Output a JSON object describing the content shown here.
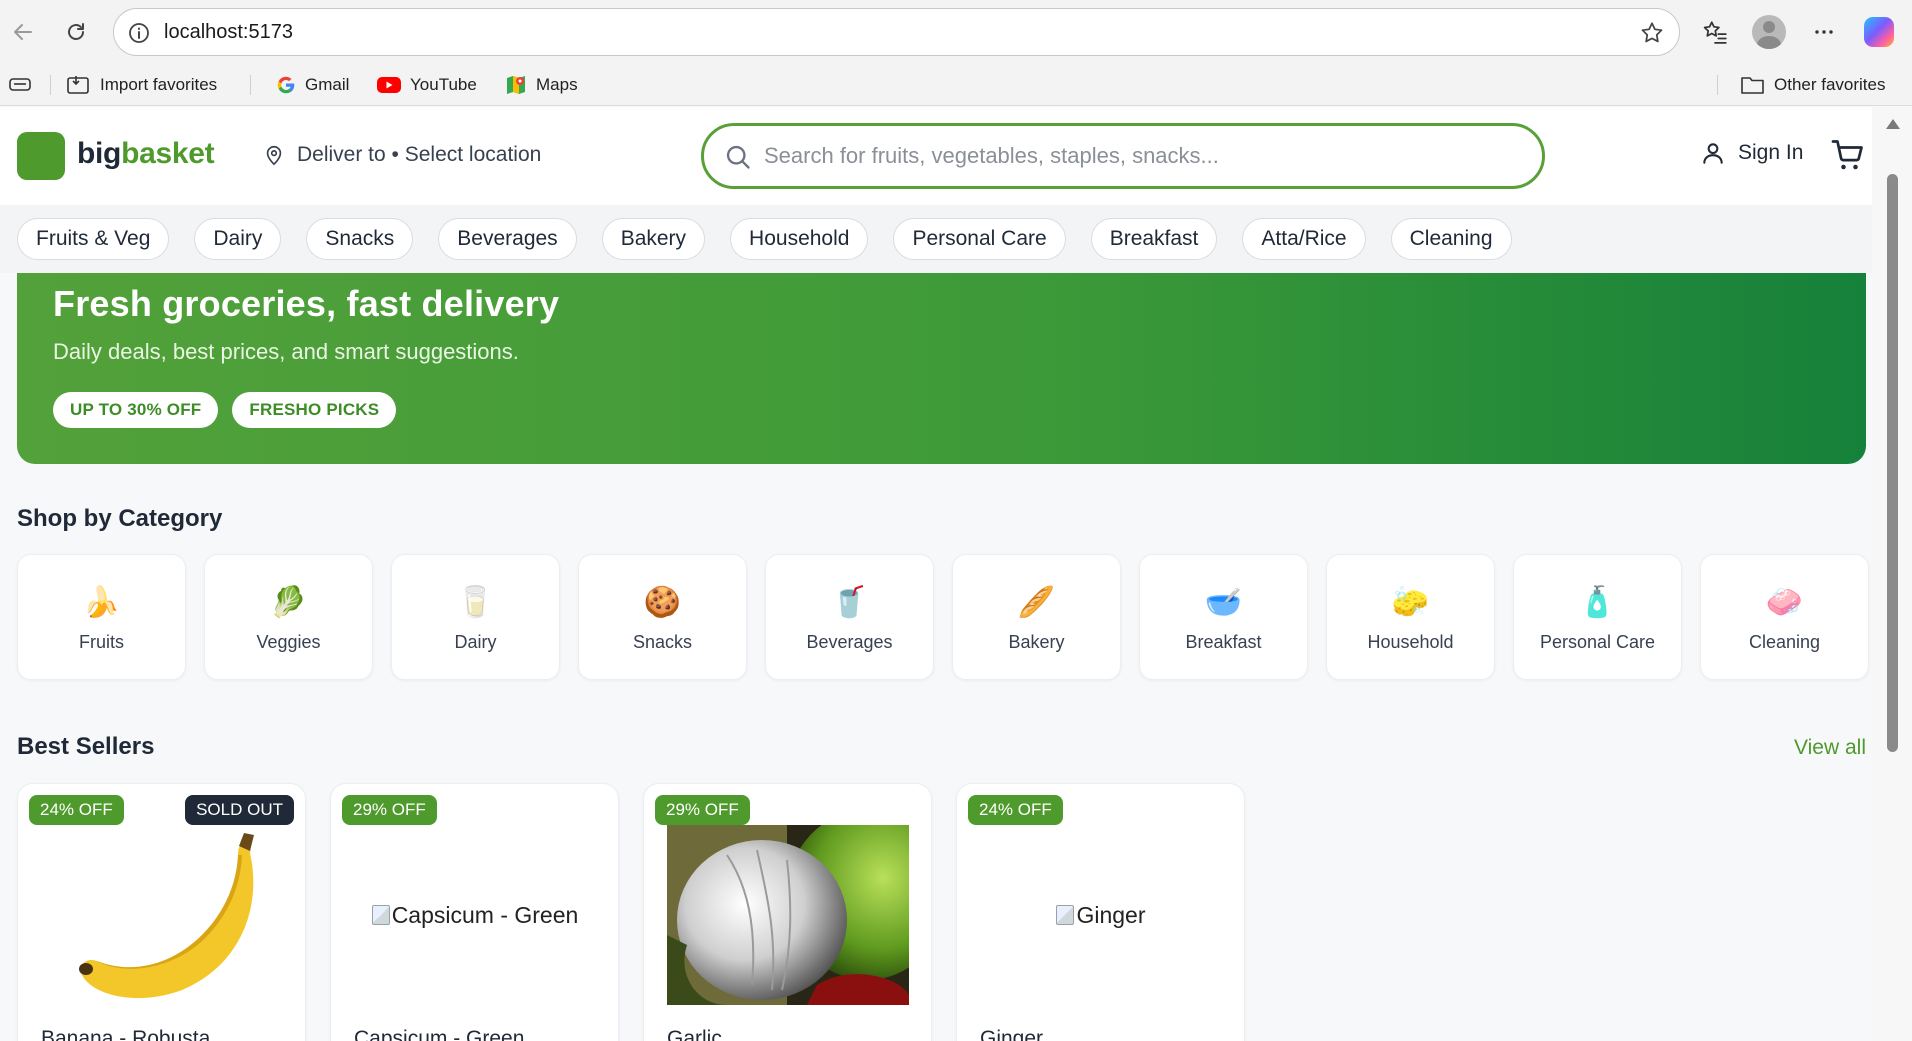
{
  "browser": {
    "url": "localhost:5173",
    "favorites": [
      {
        "label": "Import favorites",
        "icon": "import-favorites-icon"
      },
      {
        "label": "Gmail",
        "icon": "google-icon"
      },
      {
        "label": "YouTube",
        "icon": "youtube-icon"
      },
      {
        "label": "Maps",
        "icon": "maps-icon"
      }
    ],
    "other_favorites": "Other favorites"
  },
  "header": {
    "logo_big": "big",
    "logo_basket": "basket",
    "deliver_text": "Deliver to • Select location",
    "search_placeholder": "Search for fruits, vegetables, staples, snacks...",
    "sign_in": "Sign In",
    "brand_color": "#4f9a2c"
  },
  "nav_categories": [
    "Fruits & Veg",
    "Dairy",
    "Snacks",
    "Beverages",
    "Bakery",
    "Household",
    "Personal Care",
    "Breakfast",
    "Atta/Rice",
    "Cleaning"
  ],
  "hero": {
    "title": "Fresh groceries, fast delivery",
    "subtitle": "Daily deals, best prices, and smart suggestions.",
    "badges": [
      "UP TO 30% OFF",
      "FRESHO PICKS"
    ]
  },
  "shop_by_category": {
    "title": "Shop by Category",
    "items": [
      {
        "label": "Fruits",
        "emoji": "🍌",
        "icon": "banana-icon"
      },
      {
        "label": "Veggies",
        "emoji": "🥬",
        "icon": "leafy-greens-icon"
      },
      {
        "label": "Dairy",
        "emoji": "🥛",
        "icon": "milk-glass-icon"
      },
      {
        "label": "Snacks",
        "emoji": "🍪",
        "icon": "cookie-icon"
      },
      {
        "label": "Beverages",
        "emoji": "🥤",
        "icon": "cup-with-straw-icon"
      },
      {
        "label": "Bakery",
        "emoji": "🥖",
        "icon": "bread-icon"
      },
      {
        "label": "Breakfast",
        "emoji": "🥣",
        "icon": "cereal-bowl-icon"
      },
      {
        "label": "Household",
        "emoji": "🧽",
        "icon": "sponge-icon"
      },
      {
        "label": "Personal Care",
        "emoji": "🧴",
        "icon": "lotion-bottle-icon"
      },
      {
        "label": "Cleaning",
        "emoji": "🧼",
        "icon": "soap-icon"
      }
    ]
  },
  "best_sellers": {
    "title": "Best Sellers",
    "view_all": "View all",
    "products": [
      {
        "name": "Banana - Robusta",
        "discount": "24% OFF",
        "sold_out": "SOLD OUT",
        "image": "banana"
      },
      {
        "name": "Capsicum - Green",
        "discount": "29% OFF",
        "image_alt": "Capsicum - Green",
        "image": "broken"
      },
      {
        "name": "Garlic",
        "discount": "29% OFF",
        "image": "garlic-photo"
      },
      {
        "name": "Ginger",
        "discount": "24% OFF",
        "image_alt": "Ginger",
        "image": "broken"
      }
    ]
  }
}
